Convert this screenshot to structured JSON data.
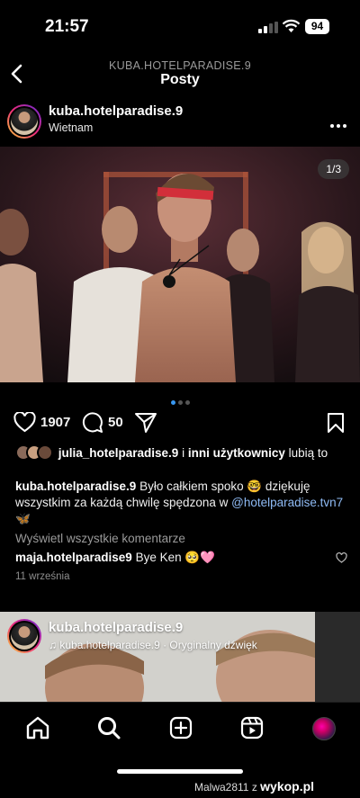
{
  "status_bar": {
    "time": "21:57",
    "battery": "94"
  },
  "header": {
    "subtitle": "KUBA.HOTELPARADISE.9",
    "title": "Posty"
  },
  "post": {
    "username": "kuba.hotelparadise.9",
    "location": "Wietnam",
    "photo_counter": "1/3",
    "carousel": {
      "count": 3,
      "active_index": 0
    },
    "likes_count": "1907",
    "comments_count": "50",
    "liked_by": {
      "user": "julia_hotelparadise.9",
      "connector": "i",
      "others": "inni użytkownicy",
      "suffix": "lubią to"
    },
    "caption": {
      "user": "kuba.hotelparadise.9",
      "text": "Było całkiem spoko 🤓 dziękuję wszystkim za każdą chwilę spędzona w",
      "mention": "@hotelparadise.tvn7",
      "emoji": "🦋"
    },
    "view_all_comments": "Wyświetl wszystkie komentarze",
    "top_comment": {
      "user": "maja.hotelparadise9",
      "text": "Bye Ken 🥺🩷"
    },
    "date": "11 września"
  },
  "next_post": {
    "username": "kuba.hotelparadise.9",
    "audio": "kuba.hotelparadise.9 · Oryginalny dźwięk"
  },
  "tabbar": {
    "items": [
      "home-icon",
      "search-icon",
      "new-post-icon",
      "reels-icon",
      "profile-avatar"
    ]
  },
  "watermark": {
    "author": "Malwa2811",
    "separator": "z",
    "site": "wykop.pl"
  },
  "colors": {
    "background": "#000000",
    "link": "#8fbbf5",
    "carousel_active": "#3897f0",
    "story_ring": "#ee2a7b"
  }
}
